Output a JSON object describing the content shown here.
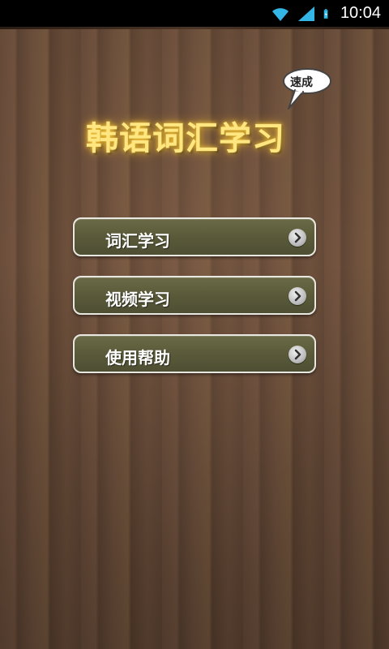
{
  "status_bar": {
    "time": "10:04",
    "icons": [
      "wifi-icon",
      "signal-icon",
      "battery-icon"
    ]
  },
  "header": {
    "title": "韩语词汇学习",
    "badge": "速成"
  },
  "menu": {
    "items": [
      {
        "label": "词汇学习",
        "icon": "chevron-right-icon"
      },
      {
        "label": "视频学习",
        "icon": "chevron-right-icon"
      },
      {
        "label": "使用帮助",
        "icon": "chevron-right-icon"
      }
    ]
  },
  "colors": {
    "title_glow": "#ffcf3a",
    "button_fill": "#5a5a3a",
    "button_border": "#e8e8e0",
    "status_icons": "#33b5e5"
  }
}
